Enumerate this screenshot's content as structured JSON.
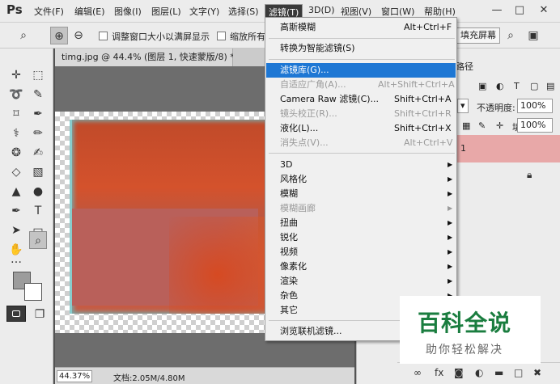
{
  "app": {
    "logo": "Ps"
  },
  "menubar": {
    "items": [
      "文件(F)",
      "编辑(E)",
      "图像(I)",
      "图层(L)",
      "文字(Y)",
      "选择(S)",
      "滤镜(T)",
      "3D(D)",
      "视图(V)",
      "窗口(W)",
      "帮助(H)"
    ],
    "active": "滤镜(T)"
  },
  "window_controls": {
    "minimize": "—",
    "maximize": "□",
    "close": "✕"
  },
  "options": {
    "resize_window": "调整窗口大小以满屏显示",
    "zoom_all": "缩放所有",
    "fill_screen": "填充屏幕"
  },
  "document": {
    "tab": "timg.jpg @ 44.4% (图层 1, 快速蒙版/8) *",
    "zoom": "44.37%",
    "doc_info": "文档:2.05M/4.80M"
  },
  "panels": {
    "tab": "路径",
    "opacity_label": "不透明度:",
    "opacity_value": "100%",
    "fill_label": "填充:",
    "fill_value": "100%",
    "layer_name": "1"
  },
  "filter_menu": {
    "items": [
      {
        "label": "高斯模糊",
        "shortcut": "Alt+Ctrl+F",
        "state": "normal"
      },
      {
        "label": "转换为智能滤镜(S)",
        "shortcut": "",
        "state": "normal"
      },
      {
        "label": "滤镜库(G)...",
        "shortcut": "",
        "state": "highlight"
      },
      {
        "label": "自适应广角(A)...",
        "shortcut": "Alt+Shift+Ctrl+A",
        "state": "disabled"
      },
      {
        "label": "Camera Raw 滤镜(C)...",
        "shortcut": "Shift+Ctrl+A",
        "state": "normal"
      },
      {
        "label": "镜头校正(R)...",
        "shortcut": "Shift+Ctrl+R",
        "state": "disabled"
      },
      {
        "label": "液化(L)...",
        "shortcut": "Shift+Ctrl+X",
        "state": "normal"
      },
      {
        "label": "消失点(V)...",
        "shortcut": "Alt+Ctrl+V",
        "state": "disabled"
      },
      {
        "label": "3D",
        "shortcut": "",
        "state": "submenu"
      },
      {
        "label": "风格化",
        "shortcut": "",
        "state": "submenu"
      },
      {
        "label": "模糊",
        "shortcut": "",
        "state": "submenu"
      },
      {
        "label": "模糊画廊",
        "shortcut": "",
        "state": "submenu-disabled"
      },
      {
        "label": "扭曲",
        "shortcut": "",
        "state": "submenu"
      },
      {
        "label": "锐化",
        "shortcut": "",
        "state": "submenu"
      },
      {
        "label": "视频",
        "shortcut": "",
        "state": "submenu"
      },
      {
        "label": "像素化",
        "shortcut": "",
        "state": "submenu"
      },
      {
        "label": "渲染",
        "shortcut": "",
        "state": "submenu"
      },
      {
        "label": "杂色",
        "shortcut": "",
        "state": "submenu"
      },
      {
        "label": "其它",
        "shortcut": "",
        "state": "submenu"
      },
      {
        "label": "浏览联机滤镜...",
        "shortcut": "",
        "state": "normal"
      }
    ]
  },
  "watermark": {
    "title": "百科全说",
    "subtitle": "助你轻松解决"
  },
  "colors": {
    "highlight": "#1e77d4",
    "foreground": "#9c9c9c",
    "background": "#ffffff",
    "watermark": "#1a7d3f"
  }
}
